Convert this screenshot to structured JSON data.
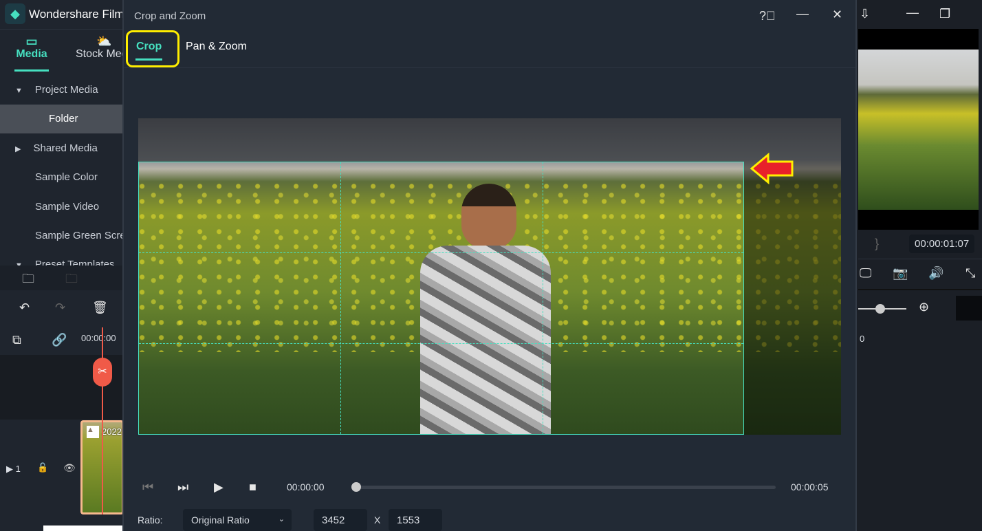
{
  "app": {
    "title": "Wondershare Filmora"
  },
  "left": {
    "tabs": [
      {
        "label": "Media",
        "icon": "folder-icon",
        "active": true
      },
      {
        "label": "Stock Media",
        "icon": "cloud-folder-icon"
      }
    ],
    "items": [
      {
        "label": "Project Media",
        "expander": "▼"
      },
      {
        "label": "Folder"
      },
      {
        "label": "Shared Media",
        "expander": "▶"
      },
      {
        "label": "Sample Color"
      },
      {
        "label": "Sample Video"
      },
      {
        "label": "Sample Green Screen"
      },
      {
        "label": "Preset Templates",
        "expander": "▼"
      }
    ],
    "timeline_time": "00:00:00",
    "track_number": "1",
    "clip_label": "2022"
  },
  "dialog": {
    "title": "Crop and Zoom",
    "tabs": [
      {
        "label": "Crop",
        "active": true
      },
      {
        "label": "Pan & Zoom"
      }
    ],
    "player": {
      "current": "00:00:00",
      "total": "00:00:05",
      "progress": 0
    },
    "ratio_label": "Ratio:",
    "ratio_value": "Original Ratio",
    "width": "3452",
    "x_label": "X",
    "height": "1553"
  },
  "right": {
    "timecode": "00:00:01:07",
    "ruler_label": "0",
    "brace": "}"
  },
  "colors": {
    "accent": "#46e0c0",
    "highlight": "#ffee00",
    "arrow": "#e8202a",
    "playhead": "#f05a48"
  }
}
